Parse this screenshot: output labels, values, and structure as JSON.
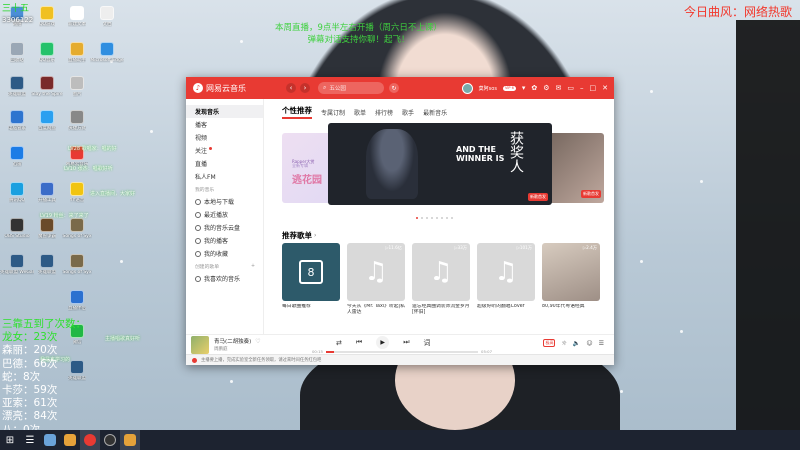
{
  "overlay": {
    "top_right": "今日曲风：网络热歌",
    "notice_line1": "本周直播，9点半左右开播（周六日不上课）",
    "notice_line2": "弹幕对话支持你聊！起飞！",
    "top_left_title": "三十五",
    "top_left_id": "3306122",
    "leaderboard": [
      {
        "text": "三靠五到了次数：",
        "white": false
      },
      {
        "text": "龙女：23次",
        "white": false
      },
      {
        "text": "森丽：20次",
        "white": true
      },
      {
        "text": "巴德：66次",
        "white": true
      },
      {
        "text": "蛇：8次",
        "white": true
      },
      {
        "text": "卡莎：59次",
        "white": true
      },
      {
        "text": "亚索：61次",
        "white": true
      },
      {
        "text": "漂亮：84次",
        "white": true
      },
      {
        "text": "八：0次",
        "white": true
      }
    ],
    "ghosts": [
      "LV28 歌唱家：唱的好",
      "LV10 张杰：唱歌好听",
      "进入直播间，大家好",
      "LV19 粉丝：来了来了",
      "主播唱歌真好听",
      "我是来学习的"
    ]
  },
  "desktop_icons": [
    {
      "label": "网络",
      "color": "#4b8ed6"
    },
    {
      "label": "QQ游戏",
      "color": "#f0c020"
    },
    {
      "label": "新建文本",
      "color": "#ffffff"
    },
    {
      "label": "文档",
      "color": "#eeeeee"
    },
    {
      "label": "回收站",
      "color": "#9aa7b5"
    },
    {
      "label": "QQ音乐",
      "color": "#25c26b"
    },
    {
      "label": "直播助手",
      "color": "#e5ac2e"
    },
    {
      "label": "Microsoft Edge",
      "color": "#2f8ee0"
    },
    {
      "label": "英雄联盟",
      "color": "#2d5a86"
    },
    {
      "label": "Slay the Spire",
      "color": "#7a2a2a"
    },
    {
      "label": "图片",
      "color": "#bdbdbd"
    },
    {
      "label": "电脑管家",
      "color": "#2e74cf"
    },
    {
      "label": "百度网盘",
      "color": "#2aa0f0"
    },
    {
      "label": "快捷方式",
      "color": "#888888"
    },
    {
      "label": "迅雷",
      "color": "#1c7ce6"
    },
    {
      "label": "网易云音乐",
      "color": "#e83a33"
    },
    {
      "label": "腾讯QQ",
      "color": "#1aa0e0"
    },
    {
      "label": "开播工具",
      "color": "#3b6cc8"
    },
    {
      "label": "YY语音",
      "color": "#f1c40f"
    },
    {
      "label": "OBS Studio",
      "color": "#333333"
    },
    {
      "label": "魔兽争霸",
      "color": "#6a4a2a"
    },
    {
      "label": "Songs of Syx",
      "color": "#7a6a4a"
    },
    {
      "label": "英雄联盟 WeGame",
      "color": "#2d5a86"
    },
    {
      "label": "英雄联盟",
      "color": "#2d5a86"
    },
    {
      "label": "Songs of Syx",
      "color": "#7a6a4a"
    },
    {
      "label": "直播伴侣",
      "color": "#2b70d0"
    },
    {
      "label": "微信",
      "color": "#21b845"
    },
    {
      "label": "英雄联盟",
      "color": "#2d5a86"
    }
  ],
  "app": {
    "name": "网易云音乐",
    "search_placeholder": "五公园",
    "username": "莫阿sos",
    "vip": "VIP 6",
    "sidebar": {
      "items_top": [
        {
          "label": "发现音乐",
          "active": true,
          "icon": "none"
        },
        {
          "label": "播客",
          "active": false,
          "icon": "none"
        },
        {
          "label": "视频",
          "active": false,
          "icon": "none"
        },
        {
          "label": "关注",
          "active": false,
          "icon": "none",
          "dot": true
        },
        {
          "label": "直播",
          "active": false,
          "icon": "none"
        },
        {
          "label": "私人FM",
          "active": false,
          "icon": "none"
        }
      ],
      "my_music_header": "我的音乐",
      "items_my": [
        {
          "label": "本地与下载",
          "icon": "download-icon"
        },
        {
          "label": "最近播放",
          "icon": "clock-icon"
        },
        {
          "label": "我的音乐云盘",
          "icon": "cloud-icon"
        },
        {
          "label": "我的播客",
          "icon": "radio-icon"
        },
        {
          "label": "我的收藏",
          "icon": "star-icon"
        }
      ],
      "created_header": "创建的歌单",
      "items_created": [
        {
          "label": "我喜欢的音乐",
          "icon": "heart-icon"
        }
      ]
    },
    "tabs": [
      {
        "label": "个性推荐",
        "active": true
      },
      {
        "label": "专属订制",
        "active": false
      },
      {
        "label": "歌单",
        "active": false
      },
      {
        "label": "排行榜",
        "active": false
      },
      {
        "label": "歌手",
        "active": false
      },
      {
        "label": "最新音乐",
        "active": false
      }
    ],
    "banner": {
      "left_small": "Rapper大赏",
      "left_title": "逃花园",
      "left_sub": "全新专辑",
      "main_en": "AND THE WINNER IS",
      "main_cn": "获奖人",
      "main_badge": "新歌首发",
      "right_text": "新歌推荐",
      "right_badge": "新歌首发"
    },
    "recommend_title": "推荐歌单",
    "playlists": [
      {
        "name": "每日歌曲推荐",
        "count": "",
        "cover": "daily",
        "day": "8"
      },
      {
        "name": "今天从《Mr. Taxi》听起|私人雷达",
        "count": "11.6亿",
        "cover": "note"
      },
      {
        "name": "遗忘经典曲调装饰流金岁月 [怀旧]",
        "count": "33万",
        "cover": "note"
      },
      {
        "name": "超级好听的翻唱Cover",
        "count": "101万",
        "cover": "note"
      },
      {
        "name": "80,90年代粤语经典",
        "count": "2.4万",
        "cover": "photo"
      }
    ],
    "player": {
      "song": "青马(二胡独奏)",
      "artist": "周鹏庭",
      "time_current": "00:15",
      "time_total": "05:07",
      "progress": 0.05,
      "hq": "极高"
    },
    "status": "主播要上播，完成实验室全新任务领取，请过来时间任务红包吧"
  },
  "colors": {
    "brand": "#e83a33"
  }
}
